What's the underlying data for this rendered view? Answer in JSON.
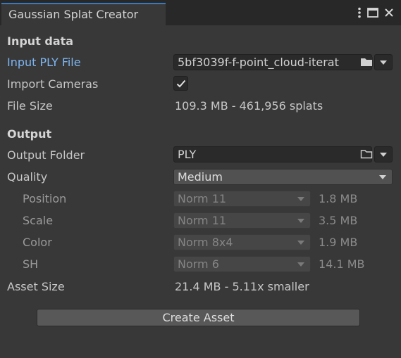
{
  "window": {
    "tab_title": "Gaussian Splat Creator",
    "icons": [
      "more-vert-icon",
      "maximize-icon",
      "close-icon"
    ]
  },
  "input_section": {
    "header": "Input data",
    "ply_label": "Input PLY File",
    "ply_value": "5bf3039f-f-point_cloud-iterat",
    "import_cameras_label": "Import Cameras",
    "import_cameras_checked": true,
    "file_size_label": "File Size",
    "file_size_value": "109.3 MB - 461,956 splats"
  },
  "output_section": {
    "header": "Output",
    "folder_label": "Output Folder",
    "folder_value": "PLY",
    "quality_label": "Quality",
    "quality_value": "Medium",
    "components": [
      {
        "label": "Position",
        "format": "Norm 11",
        "size": "1.8 MB"
      },
      {
        "label": "Scale",
        "format": "Norm 11",
        "size": "3.5 MB"
      },
      {
        "label": "Color",
        "format": "Norm 8x4",
        "size": "1.9 MB"
      },
      {
        "label": "SH",
        "format": "Norm 6",
        "size": "14.1 MB"
      }
    ],
    "asset_size_label": "Asset Size",
    "asset_size_value": "21.4 MB - 5.11x smaller"
  },
  "actions": {
    "create_label": "Create Asset"
  },
  "colors": {
    "accent_blue": "#3a79bb",
    "link_label": "#7eb6f2",
    "window_bg": "#383838"
  }
}
